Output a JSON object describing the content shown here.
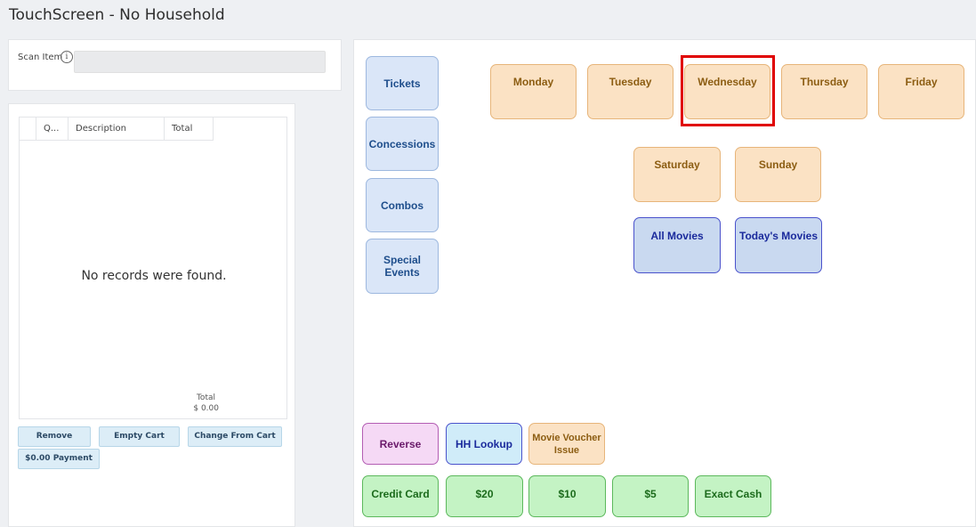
{
  "window": {
    "title": "TouchScreen - No Household"
  },
  "scan": {
    "label": "Scan Item",
    "info_icon": "info-icon",
    "value": ""
  },
  "cart": {
    "columns": [
      "Q...",
      "Description",
      "Total"
    ],
    "empty_message": "No records were found.",
    "total_label": "Total",
    "total_value": "$ 0.00",
    "buttons": {
      "remove": "Remove",
      "empty_cart": "Empty Cart",
      "change_from_cart": "Change From Cart",
      "payment": "$0.00 Payment"
    }
  },
  "categories": [
    "Tickets",
    "Concessions",
    "Combos",
    "Special Events"
  ],
  "days": [
    "Monday",
    "Tuesday",
    "Wednesday",
    "Thursday",
    "Friday",
    "Saturday",
    "Sunday"
  ],
  "movies": {
    "all": "All Movies",
    "today": "Today's Movies"
  },
  "actions": {
    "reverse": "Reverse",
    "hh_lookup": "HH Lookup",
    "voucher": "Movie Voucher Issue"
  },
  "payments": [
    "Credit Card",
    "$20",
    "$10",
    "$5",
    "Exact Cash"
  ],
  "highlighted_button": "Wednesday",
  "colors": {
    "highlight": "#e00000",
    "day": "#fbe2c4",
    "category": "#dae6f8",
    "payment": "#c4f3c4"
  }
}
